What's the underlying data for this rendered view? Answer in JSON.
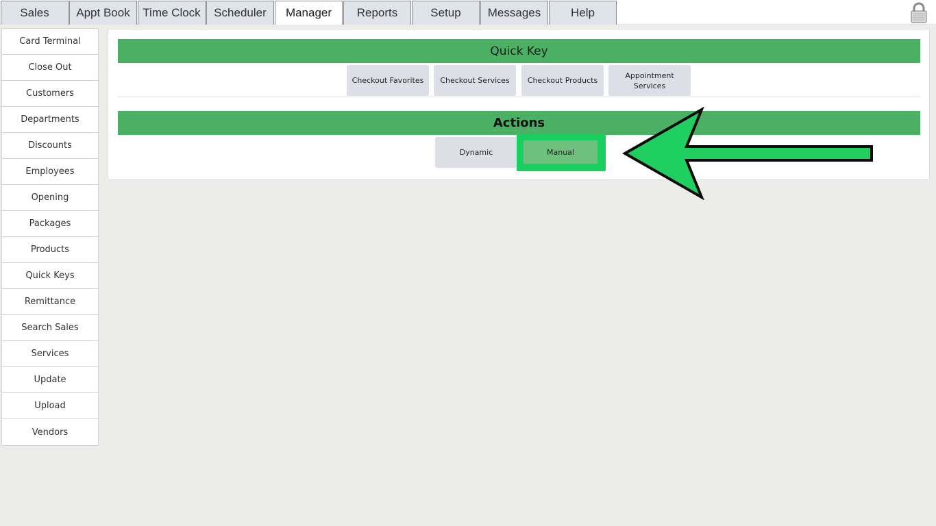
{
  "tabs": [
    {
      "label": "Sales"
    },
    {
      "label": "Appt Book"
    },
    {
      "label": "Time Clock"
    },
    {
      "label": "Scheduler"
    },
    {
      "label": "Manager"
    },
    {
      "label": "Reports"
    },
    {
      "label": "Setup"
    },
    {
      "label": "Messages"
    },
    {
      "label": "Help"
    }
  ],
  "active_tab": "Manager",
  "lock_icon": "lock-icon",
  "sidebar": {
    "items": [
      {
        "label": "Card Terminal"
      },
      {
        "label": "Close Out"
      },
      {
        "label": "Customers"
      },
      {
        "label": "Departments"
      },
      {
        "label": "Discounts"
      },
      {
        "label": "Employees"
      },
      {
        "label": "Opening"
      },
      {
        "label": "Packages"
      },
      {
        "label": "Products"
      },
      {
        "label": "Quick Keys"
      },
      {
        "label": "Remittance"
      },
      {
        "label": "Search Sales"
      },
      {
        "label": "Services"
      },
      {
        "label": "Update"
      },
      {
        "label": "Upload"
      },
      {
        "label": "Vendors"
      }
    ]
  },
  "quick_key": {
    "title": "Quick Key",
    "buttons": [
      {
        "label": "Checkout Favorites"
      },
      {
        "label": "Checkout Services"
      },
      {
        "label": "Checkout Products"
      },
      {
        "label": "Appointment Services"
      }
    ]
  },
  "actions": {
    "title": "Actions",
    "dynamic_label": "Dynamic",
    "manual_label": "Manual"
  },
  "colors": {
    "section_header": "#4cb064",
    "highlight": "#19cf5f",
    "annotation_arrow": "#1fd060"
  }
}
